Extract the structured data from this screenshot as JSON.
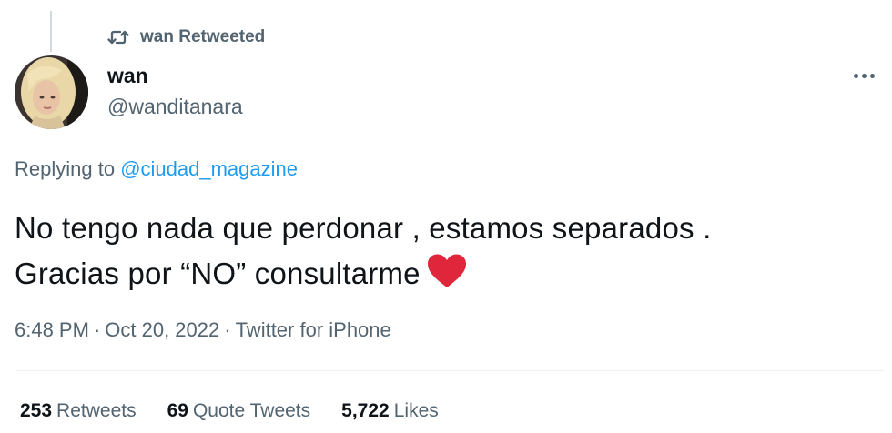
{
  "retweet_header": {
    "icon": "retweet-icon",
    "text": "wan Retweeted"
  },
  "author": {
    "name": "wan",
    "handle": "@wanditanara",
    "avatar": "avatar"
  },
  "more_icon": "more-icon",
  "reply": {
    "prefix": "Replying to",
    "mention": "@ciudad_magazine"
  },
  "tweet": {
    "line1": "No tengo nada que perdonar , estamos separados .",
    "line2": "Gracias por “NO” consultarme",
    "emoji": "red-heart-icon",
    "heart_color": "#e0263a"
  },
  "meta": {
    "time": "6:48 PM",
    "separator": "·",
    "date": "Oct 20, 2022",
    "source": "Twitter for iPhone"
  },
  "stats": {
    "retweets_count": "253",
    "retweets_label": "Retweets",
    "quotes_count": "69",
    "quotes_label": "Quote Tweets",
    "likes_count": "5,722",
    "likes_label": "Likes"
  },
  "colors": {
    "primary_text": "#0f1419",
    "secondary_text": "#536471",
    "link": "#1d9bf0",
    "divider": "#eff3f4"
  }
}
